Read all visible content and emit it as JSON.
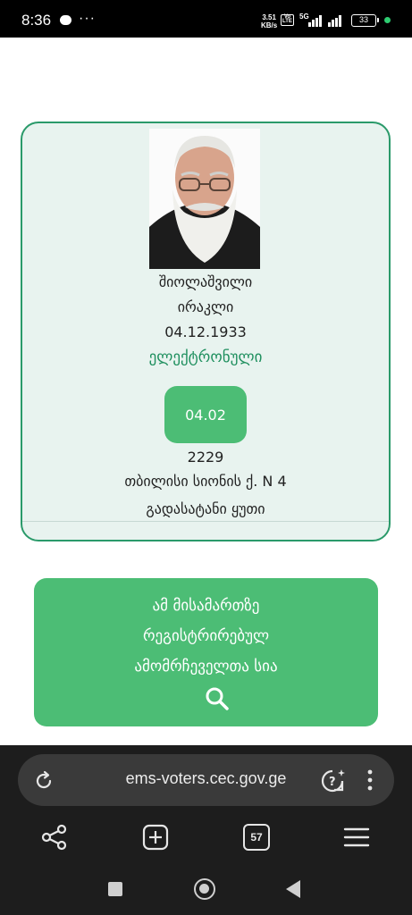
{
  "status_bar": {
    "time": "8:36",
    "notification_icons": [
      "chat-icon",
      "more-dots-icon"
    ],
    "speed_value": "3.51",
    "speed_unit": "KB/s",
    "volte": "Vo LTE",
    "network": "5G",
    "battery": "33",
    "dot_color": "#2ecc71"
  },
  "voter": {
    "last_name": "შიოლაშვილი",
    "first_name": "ირაკლი",
    "birth_date": "04.12.1933",
    "list_type": "ელექტრონული",
    "badge_date": "04.02",
    "precinct_number": "2229",
    "address": "თბილისი სიონის ქ. N 4",
    "location": "გადასატანი ყუთი"
  },
  "search_card": {
    "line1": "ამ მისამართზე",
    "line2": "რეგისტრირებულ",
    "line3": "ამომრჩეველთა სია",
    "icon": "search-icon"
  },
  "browser": {
    "url": "ems-voters.cec.gov.ge",
    "tab_count": "57",
    "icons": [
      "reload-icon",
      "assistant-icon",
      "more-vert-icon",
      "share-icon",
      "new-tab-icon",
      "tabs-icon",
      "menu-icon"
    ]
  },
  "colors": {
    "accent_green": "#4cbd75",
    "card_border": "#2a9a6a",
    "card_bg": "#e8f3ef",
    "link_green": "#1e8f5e"
  }
}
